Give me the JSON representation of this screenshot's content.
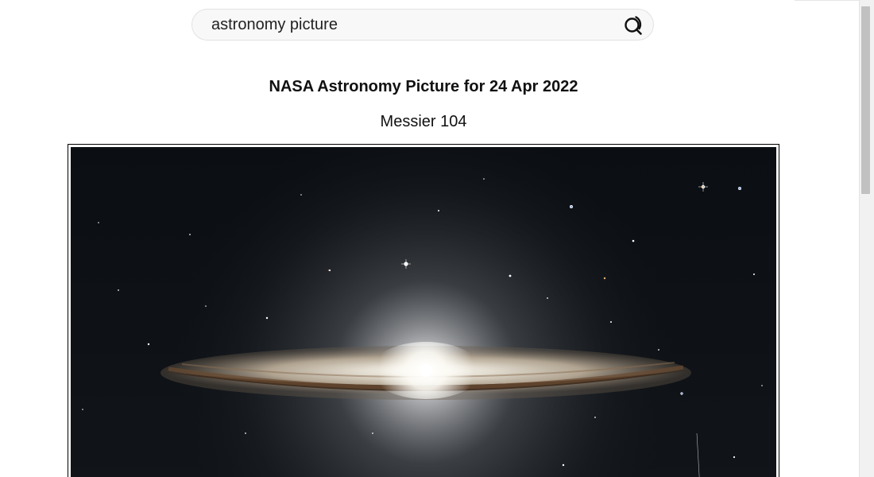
{
  "search": {
    "value": "astronomy picture"
  },
  "apod": {
    "title": "NASA Astronomy Picture for 24 Apr 2022",
    "subtitle": "Messier 104"
  },
  "icons": {
    "search": "search-icon"
  },
  "colors": {
    "image_background": "#0c1014",
    "galaxy_core": "#ffffff",
    "dust_lane": "#4a3322"
  }
}
